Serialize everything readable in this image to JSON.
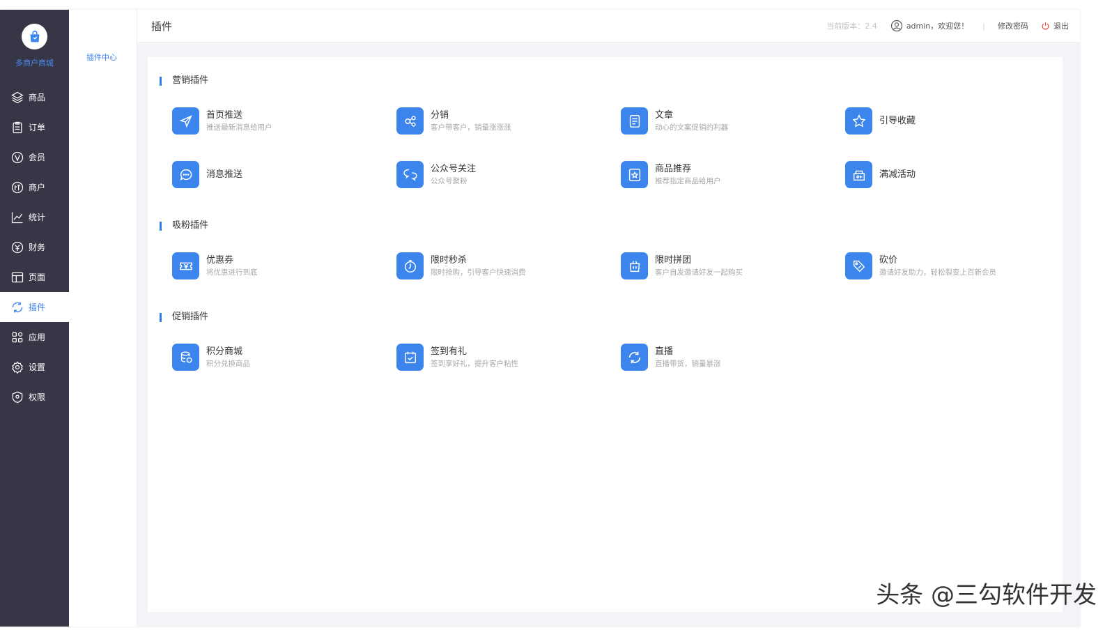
{
  "sidebar": {
    "logo_text": "多商户商城",
    "items": [
      {
        "label": "商品",
        "icon": "layers-icon"
      },
      {
        "label": "订单",
        "icon": "clipboard-icon"
      },
      {
        "label": "会员",
        "icon": "vip-icon"
      },
      {
        "label": "商户",
        "icon": "merchant-icon"
      },
      {
        "label": "统计",
        "icon": "chart-icon"
      },
      {
        "label": "财务",
        "icon": "finance-icon"
      },
      {
        "label": "页面",
        "icon": "page-icon"
      },
      {
        "label": "插件",
        "icon": "plugin-icon"
      },
      {
        "label": "应用",
        "icon": "apps-icon"
      },
      {
        "label": "设置",
        "icon": "gear-icon"
      },
      {
        "label": "权限",
        "icon": "shield-icon"
      }
    ],
    "active_index": 7
  },
  "submenu": {
    "items": [
      {
        "label": "插件中心"
      }
    ]
  },
  "header": {
    "title": "插件",
    "version": "当前版本：2.4",
    "user": "admin，欢迎您！",
    "separator": "|",
    "change_password": "修改密码",
    "logout": "退出"
  },
  "sections": [
    {
      "title": "营销插件",
      "plugins": [
        {
          "name": "首页推送",
          "desc": "推送最新消息给用户",
          "icon": "send-icon"
        },
        {
          "name": "分销",
          "desc": "客户带客户，销量涨涨涨",
          "icon": "share-icon"
        },
        {
          "name": "文章",
          "desc": "动心的文案促销的利器",
          "icon": "article-icon"
        },
        {
          "name": "引导收藏",
          "desc": "",
          "icon": "star-icon"
        },
        {
          "name": "消息推送",
          "desc": "",
          "icon": "message-icon"
        },
        {
          "name": "公众号关注",
          "desc": "公众号聚粉",
          "icon": "chat-icon"
        },
        {
          "name": "商品推荐",
          "desc": "推荐指定商品给用户",
          "icon": "recommend-icon"
        },
        {
          "name": "满减活动",
          "desc": "",
          "icon": "discount-icon"
        }
      ]
    },
    {
      "title": "吸粉插件",
      "plugins": [
        {
          "name": "优惠券",
          "desc": "将优惠进行到底",
          "icon": "coupon-icon"
        },
        {
          "name": "限时秒杀",
          "desc": "限时抢购，引导客户快速消费",
          "icon": "timer-icon"
        },
        {
          "name": "限时拼团",
          "desc": "客户自发邀请好友一起购买",
          "icon": "group-buy-icon"
        },
        {
          "name": "砍价",
          "desc": "邀请好友助力，轻松裂变上百新会员",
          "icon": "price-tag-icon"
        }
      ]
    },
    {
      "title": "促销插件",
      "plugins": [
        {
          "name": "积分商城",
          "desc": "积分兑换商品",
          "icon": "points-icon"
        },
        {
          "name": "签到有礼",
          "desc": "签到享好礼，提升客户粘性",
          "icon": "checkin-icon"
        },
        {
          "name": "直播",
          "desc": "直播带货，销量暴涨",
          "icon": "live-icon"
        }
      ]
    }
  ],
  "watermark": "头条 @三勾软件开发",
  "colors": {
    "sidebar": "#363646",
    "accent": "#3d82ee",
    "icon_bg": "#3c85ed"
  }
}
